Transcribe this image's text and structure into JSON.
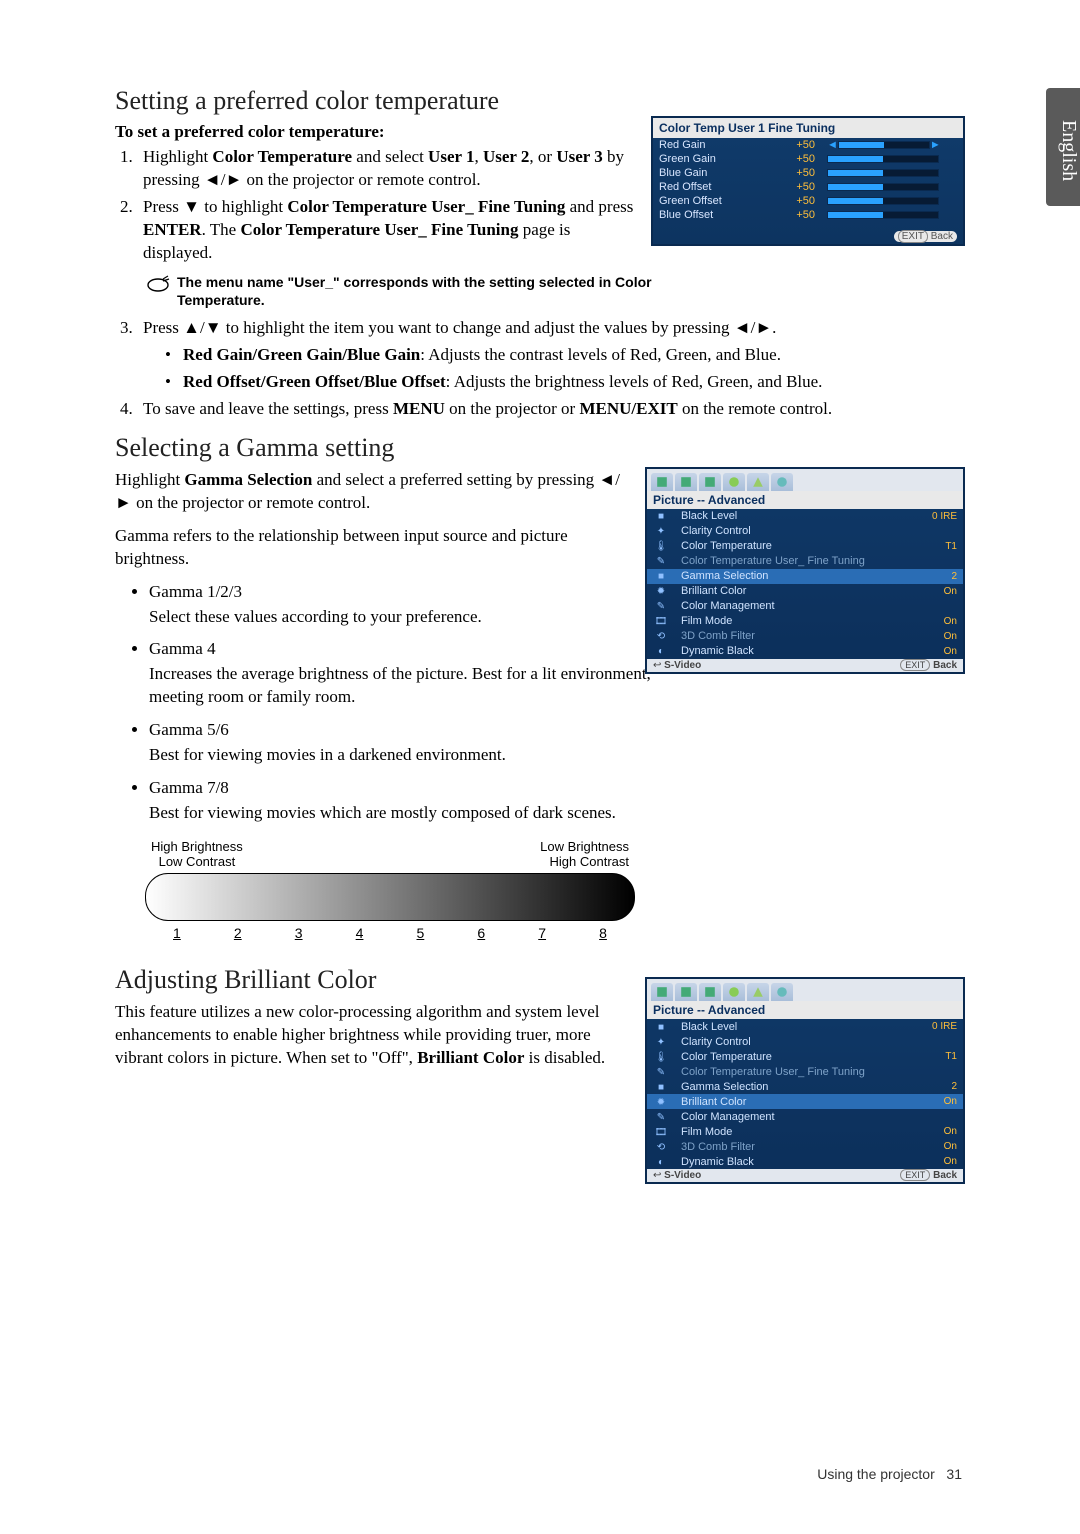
{
  "language_tab": "English",
  "section1": {
    "title": "Setting a preferred color temperature",
    "subhead": "To set a preferred color temperature:",
    "step1_a": "Highlight ",
    "step1_b": "Color Temperature",
    "step1_c": " and select ",
    "step1_d": "User 1",
    "step1_e": ", ",
    "step1_f": "User 2",
    "step1_g": ", or ",
    "step1_h": "User 3",
    "step1_i": " by pressing ◄/► on the projector or remote control.",
    "step2_a": "Press ▼ to highlight ",
    "step2_b": "Color Temperature User_ Fine Tuning",
    "step2_c": " and press ",
    "step2_d": "ENTER",
    "step2_e": ". The ",
    "step2_f": "Color Temperature User_ Fine Tuning",
    "step2_g": " page is displayed.",
    "note": "The menu name \"User_\" corresponds with the setting selected in Color Temperature.",
    "step3": "Press ▲/▼ to highlight the item you want to change and adjust the values by pressing ◄/►.",
    "sub1_a": "Red Gain/Green Gain/Blue Gain",
    "sub1_b": ": Adjusts the contrast levels of Red, Green, and Blue.",
    "sub2_a": "Red Offset/Green Offset/Blue Offset",
    "sub2_b": ": Adjusts the brightness levels of Red, Green, and Blue.",
    "step4_a": "To save and leave the settings, press ",
    "step4_b": "MENU",
    "step4_c": " on the projector or ",
    "step4_d": "MENU/EXIT",
    "step4_e": " on the remote control."
  },
  "osd1": {
    "title": "Color Temp User 1 Fine Tuning",
    "rows": [
      {
        "label": "Red Gain",
        "value": "+50"
      },
      {
        "label": "Green Gain",
        "value": "+50"
      },
      {
        "label": "Blue Gain",
        "value": "+50"
      },
      {
        "label": "Red Offset",
        "value": "+50"
      },
      {
        "label": "Green Offset",
        "value": "+50"
      },
      {
        "label": "Blue Offset",
        "value": "+50"
      }
    ],
    "footer_exit": "EXIT",
    "footer_back": "Back"
  },
  "section2": {
    "title": "Selecting a Gamma setting",
    "intro_a": "Highlight ",
    "intro_b": "Gamma Selection",
    "intro_c": " and select a preferred setting by pressing ◄/► on the projector or remote control.",
    "para": "Gamma refers to the relationship between input source and picture brightness.",
    "g1_t": "Gamma 1/2/3",
    "g1_d": "Select these values according to your preference.",
    "g2_t": "Gamma 4",
    "g2_d": "Increases the average brightness of the picture. Best for a lit environment, meeting room or family room.",
    "g3_t": "Gamma 5/6",
    "g3_d": "Best for viewing movies in a darkened environment.",
    "g4_t": "Gamma 7/8",
    "g4_d": "Best for viewing movies which are mostly composed of dark scenes.",
    "fig_left_a": "High Brightness",
    "fig_left_b": "Low Contrast",
    "fig_right_a": "Low Brightness",
    "fig_right_b": "High Contrast",
    "nums": [
      "1",
      "2",
      "3",
      "4",
      "5",
      "6",
      "7",
      "8"
    ]
  },
  "osd_adv_common": {
    "title": "Picture -- Advanced",
    "footer_source_icon": "↩",
    "footer_source": "S-Video",
    "footer_exit": "EXIT",
    "footer_back": "Back"
  },
  "osd2": {
    "rows": [
      {
        "icon": "■",
        "label": "Black Level",
        "value": "0 IRE",
        "cls": ""
      },
      {
        "icon": "✦",
        "label": "Clarity Control",
        "value": "",
        "cls": ""
      },
      {
        "icon": "🌡",
        "label": "Color Temperature",
        "value": "T1",
        "cls": ""
      },
      {
        "icon": "✎",
        "label": "Color Temperature User_ Fine Tuning",
        "value": "",
        "cls": "gray"
      },
      {
        "icon": "■",
        "label": "Gamma Selection",
        "value": "2",
        "cls": "hl"
      },
      {
        "icon": "✹",
        "label": "Brilliant Color",
        "value": "On",
        "cls": ""
      },
      {
        "icon": "✎",
        "label": "Color Management",
        "value": "",
        "cls": ""
      },
      {
        "icon": "🎞",
        "label": "Film Mode",
        "value": "On",
        "cls": ""
      },
      {
        "icon": "⟲",
        "label": "3D Comb Filter",
        "value": "On",
        "cls": "gray"
      },
      {
        "icon": "◐",
        "label": "Dynamic Black",
        "value": "On",
        "cls": ""
      }
    ]
  },
  "osd3": {
    "rows": [
      {
        "icon": "■",
        "label": "Black Level",
        "value": "0 IRE",
        "cls": ""
      },
      {
        "icon": "✦",
        "label": "Clarity Control",
        "value": "",
        "cls": ""
      },
      {
        "icon": "🌡",
        "label": "Color Temperature",
        "value": "T1",
        "cls": ""
      },
      {
        "icon": "✎",
        "label": "Color Temperature User_ Fine Tuning",
        "value": "",
        "cls": "gray"
      },
      {
        "icon": "■",
        "label": "Gamma Selection",
        "value": "2",
        "cls": ""
      },
      {
        "icon": "✹",
        "label": "Brilliant Color",
        "value": "On",
        "cls": "hl"
      },
      {
        "icon": "✎",
        "label": "Color Management",
        "value": "",
        "cls": ""
      },
      {
        "icon": "🎞",
        "label": "Film Mode",
        "value": "On",
        "cls": ""
      },
      {
        "icon": "⟲",
        "label": "3D Comb Filter",
        "value": "On",
        "cls": "gray"
      },
      {
        "icon": "◐",
        "label": "Dynamic Black",
        "value": "On",
        "cls": ""
      }
    ]
  },
  "section3": {
    "title": "Adjusting Brilliant Color",
    "para_a": "This feature utilizes a new color-processing algorithm and system level enhancements to enable higher brightness while providing truer, more vibrant colors in picture. When set to \"Off\", ",
    "para_b": "Brilliant Color",
    "para_c": " is disabled."
  },
  "page_footer": {
    "label": "Using the projector",
    "num": "31"
  }
}
